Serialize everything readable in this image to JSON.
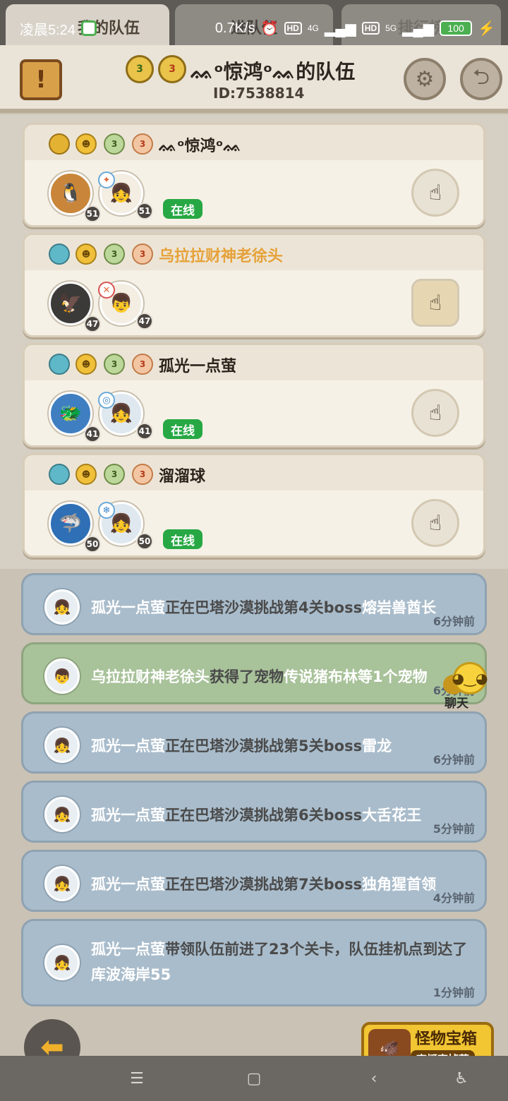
{
  "status_bar": {
    "time": "凌晨5:24",
    "network_speed": "0.7K/s",
    "hd1": "HD",
    "net1": "4G",
    "hd2": "HD",
    "net2": "5G",
    "battery": "100"
  },
  "tabs": [
    {
      "label": "我的队伍"
    },
    {
      "label": "进队伍"
    },
    {
      "label": "排行榜"
    }
  ],
  "header": {
    "title": "ᨐᵒ惊鸿ᵒᨐ的队伍",
    "team_id": "ID:7538814",
    "medal1": "3",
    "medal2": "3",
    "scroll_icon": "!"
  },
  "members": [
    {
      "name": "ᨐᵒ惊鸿ᵒᨐ",
      "pet_level": "51",
      "char_level": "51",
      "status": "在线",
      "rank": "3"
    },
    {
      "name": "乌拉拉财神老徐头",
      "pet_level": "47",
      "char_level": "47",
      "status": "",
      "rank": "3"
    },
    {
      "name": "孤光一点萤",
      "pet_level": "41",
      "char_level": "41",
      "status": "在线",
      "rank": "3"
    },
    {
      "name": "溜溜球",
      "pet_level": "50",
      "char_level": "50",
      "status": "在线",
      "rank": "3"
    }
  ],
  "feed": [
    {
      "who": "孤光一点萤",
      "mid": "正在巴塔沙漠挑战第4关boss",
      "tail": "熔岩兽酋长",
      "time": "6分钟前"
    },
    {
      "who": "乌拉拉财神老徐头",
      "mid": "获得了宠物",
      "tail": "传说猪布林等1个宠物",
      "time": "6分钟前"
    },
    {
      "who": "孤光一点萤",
      "mid": "正在巴塔沙漠挑战第5关boss",
      "tail": "雷龙",
      "time": "6分钟前"
    },
    {
      "who": "孤光一点萤",
      "mid": "正在巴塔沙漠挑战第6关boss",
      "tail": "大舌花王",
      "time": "5分钟前"
    },
    {
      "who": "孤光一点萤",
      "mid": "正在巴塔沙漠挑战第7关boss",
      "tail": "独角猩首领",
      "time": "4分钟前"
    },
    {
      "who": "孤光一点萤",
      "mid": "带领队伍前进了23个关卡，队伍挂机点到达了",
      "tail": "库波海岸55",
      "time": "1分钟前"
    }
  ],
  "chat": {
    "label": "聊天"
  },
  "chest": {
    "title": "怪物宝箱",
    "subtitle": "高概率掉落"
  },
  "colors": {
    "online": "#27a844",
    "vip_name": "#e6a23a",
    "feed_blue": "#a9bccb",
    "feed_green": "#a8c29a"
  }
}
